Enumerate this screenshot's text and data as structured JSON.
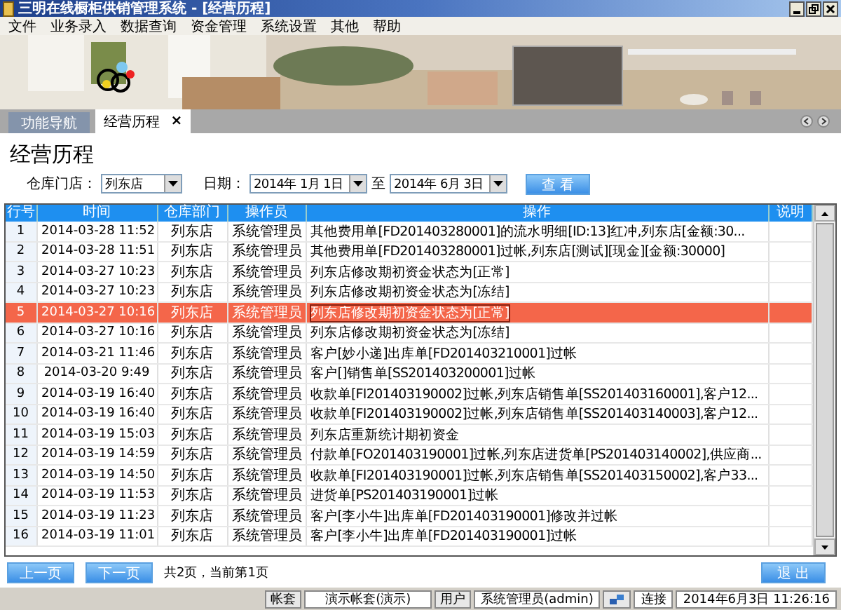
{
  "window": {
    "title": "三明在线橱柜供销管理系统 - [经营历程]"
  },
  "menu": [
    "文件",
    "业务录入",
    "数据查询",
    "资金管理",
    "系统设置",
    "其他",
    "帮助"
  ],
  "tabs": [
    {
      "label": "功能导航",
      "selected": false,
      "closable": false
    },
    {
      "label": "经营历程",
      "selected": true,
      "closable": true,
      "close": "×"
    }
  ],
  "page_title": "经营历程",
  "filters": {
    "store_label": "仓库门店：",
    "store": "列东店",
    "date_label": "日期：",
    "date_from": "2014年 1月 1日",
    "to_label": "至",
    "date_to": "2014年 6月 3日",
    "search_button": "查 看"
  },
  "table": {
    "columns": [
      "行号",
      "时间",
      "仓库部门",
      "操作员",
      "操作",
      "说明"
    ],
    "rows": [
      {
        "cells": [
          "1",
          "2014-03-28 11:52",
          "列东店",
          "系统管理员",
          "其他费用单[FD201403280001]的流水明细[ID:13]红冲,列东店[金额:30...",
          ""
        ],
        "selected": false
      },
      {
        "cells": [
          "2",
          "2014-03-28 11:51",
          "列东店",
          "系统管理员",
          "其他费用单[FD201403280001]过帐,列东店[测试][现金][金额:30000]",
          ""
        ],
        "selected": false
      },
      {
        "cells": [
          "3",
          "2014-03-27 10:23",
          "列东店",
          "系统管理员",
          "列东店修改期初资金状态为[正常]",
          ""
        ],
        "selected": false
      },
      {
        "cells": [
          "4",
          "2014-03-27 10:23",
          "列东店",
          "系统管理员",
          "列东店修改期初资金状态为[冻结]",
          ""
        ],
        "selected": false
      },
      {
        "cells": [
          "5",
          "2014-03-27 10:16",
          "列东店",
          "系统管理员",
          "列东店修改期初资金状态为[正常]",
          ""
        ],
        "selected": true
      },
      {
        "cells": [
          "6",
          "2014-03-27 10:16",
          "列东店",
          "系统管理员",
          "列东店修改期初资金状态为[冻结]",
          ""
        ],
        "selected": false
      },
      {
        "cells": [
          "7",
          "2014-03-21 11:46",
          "列东店",
          "系统管理员",
          "客户[妙小递]出库单[FD201403210001]过帐",
          ""
        ],
        "selected": false
      },
      {
        "cells": [
          "8",
          "2014-03-20 9:49",
          "列东店",
          "系统管理员",
          "客户[]销售单[SS201403200001]过帐",
          ""
        ],
        "selected": false
      },
      {
        "cells": [
          "9",
          "2014-03-19 16:40",
          "列东店",
          "系统管理员",
          "收款单[FI201403190002]过帐,列东店销售单[SS201403160001],客户12...",
          ""
        ],
        "selected": false
      },
      {
        "cells": [
          "10",
          "2014-03-19 16:40",
          "列东店",
          "系统管理员",
          "收款单[FI201403190002]过帐,列东店销售单[SS201403140003],客户12...",
          ""
        ],
        "selected": false
      },
      {
        "cells": [
          "11",
          "2014-03-19 15:03",
          "列东店",
          "系统管理员",
          "列东店重新统计期初资金",
          ""
        ],
        "selected": false
      },
      {
        "cells": [
          "12",
          "2014-03-19 14:59",
          "列东店",
          "系统管理员",
          "付款单[FO201403190001]过帐,列东店进货单[PS201403140002],供应商...",
          ""
        ],
        "selected": false
      },
      {
        "cells": [
          "13",
          "2014-03-19 14:50",
          "列东店",
          "系统管理员",
          "收款单[FI201403190001]过帐,列东店销售单[SS201403150002],客户33...",
          ""
        ],
        "selected": false
      },
      {
        "cells": [
          "14",
          "2014-03-19 11:53",
          "列东店",
          "系统管理员",
          "进货单[PS201403190001]过帐",
          ""
        ],
        "selected": false
      },
      {
        "cells": [
          "15",
          "2014-03-19 11:23",
          "列东店",
          "系统管理员",
          "客户[李小牛]出库单[FD201403190001]修改并过帐",
          ""
        ],
        "selected": false
      },
      {
        "cells": [
          "16",
          "2014-03-19 11:01",
          "列东店",
          "系统管理员",
          "客户[李小牛]出库单[FD201403190001]过帐",
          ""
        ],
        "selected": false
      }
    ]
  },
  "pager": {
    "prev": "上一页",
    "next": "下一页",
    "info": "共2页，当前第1页"
  },
  "exit_button": "退 出",
  "status_bar": {
    "account_label": "帐套",
    "account": "演示帐套(演示)",
    "user_label": "用户",
    "user": "系统管理员(admin)",
    "connection": "连接",
    "datetime": "2014年6月3日 11:26:16"
  }
}
